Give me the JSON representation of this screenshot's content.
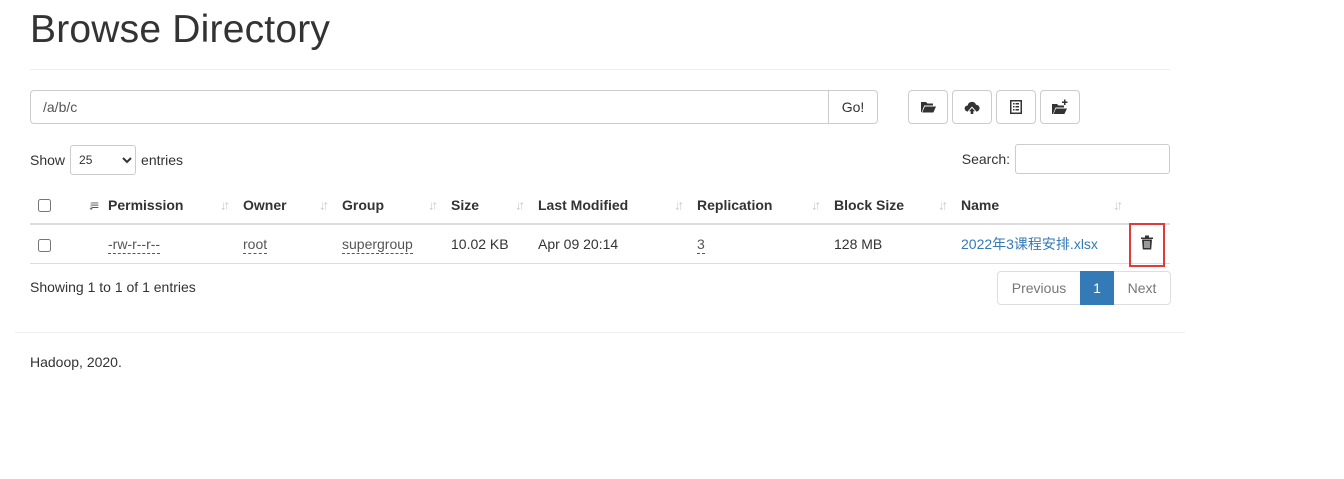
{
  "page": {
    "title": "Browse Directory"
  },
  "path_bar": {
    "value": "/a/b/c",
    "go_label": "Go!"
  },
  "toolbar": {
    "icons": [
      "folder-open-icon",
      "cloud-upload-icon",
      "list-alt-icon",
      "folder-plus-icon"
    ]
  },
  "length": {
    "show_label": "Show",
    "selected": "25",
    "options": [
      "25"
    ],
    "entries_label": "entries"
  },
  "search": {
    "label": "Search:",
    "value": ""
  },
  "table": {
    "columns": [
      "Permission",
      "Owner",
      "Group",
      "Size",
      "Last Modified",
      "Replication",
      "Block Size",
      "Name"
    ],
    "rows": [
      {
        "permission": "-rw-r--r--",
        "owner": "root",
        "group": "supergroup",
        "size": "10.02 KB",
        "last_modified": "Apr 09 20:14",
        "replication": "3",
        "block_size": "128 MB",
        "name": "2022年3课程安排.xlsx",
        "action_icon": "trash-icon"
      }
    ]
  },
  "info": {
    "text": "Showing 1 to 1 of 1 entries"
  },
  "pagination": {
    "previous": "Previous",
    "current": "1",
    "next": "Next"
  },
  "footer": {
    "text": "Hadoop, 2020."
  },
  "colors": {
    "link": "#337ab7",
    "active_page": "#337ab7",
    "highlight_box": "#e03a3a"
  }
}
